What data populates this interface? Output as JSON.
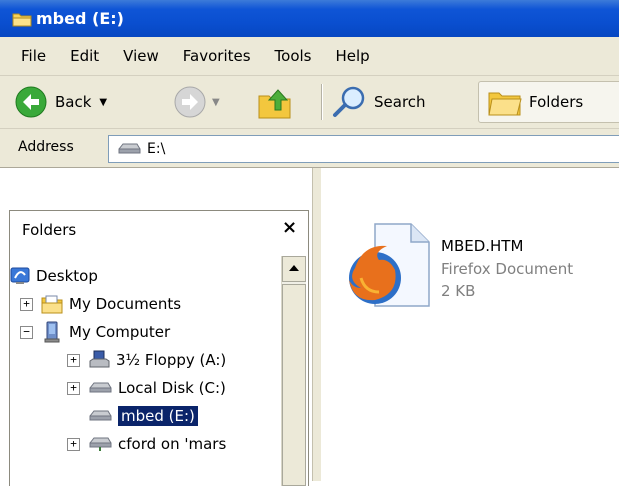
{
  "window": {
    "title": "mbed (E:)",
    "title_icon": "folder-icon"
  },
  "menu": {
    "items": [
      "File",
      "Edit",
      "View",
      "Favorites",
      "Tools",
      "Help"
    ]
  },
  "toolbar": {
    "back_label": "Back",
    "search_label": "Search",
    "folders_label": "Folders"
  },
  "address": {
    "label": "Address",
    "value": "E:\\"
  },
  "folders_pane": {
    "title": "Folders",
    "close": "×",
    "tree": [
      {
        "label": "Desktop",
        "icon": "desktop-icon",
        "expander": ""
      },
      {
        "label": "My Documents",
        "icon": "my-documents-icon",
        "expander": "+"
      },
      {
        "label": "My Computer",
        "icon": "my-computer-icon",
        "expander": "−"
      },
      {
        "label": "3½ Floppy (A:)",
        "icon": "floppy-drive-icon",
        "expander": "+"
      },
      {
        "label": "Local Disk (C:)",
        "icon": "disk-drive-icon",
        "expander": "+"
      },
      {
        "label": "mbed (E:)",
        "icon": "disk-drive-icon",
        "expander": "",
        "selected": true
      },
      {
        "label": "cford on 'mars",
        "icon": "network-drive-icon",
        "expander": "+"
      }
    ]
  },
  "files": [
    {
      "name": "MBED.HTM",
      "type": "Firefox Document",
      "size": "2 KB",
      "icon": "firefox-document-icon"
    }
  ],
  "colors": {
    "titlebar": "#0a4fd0",
    "selection": "#0a246a",
    "chrome": "#ece9d8"
  }
}
